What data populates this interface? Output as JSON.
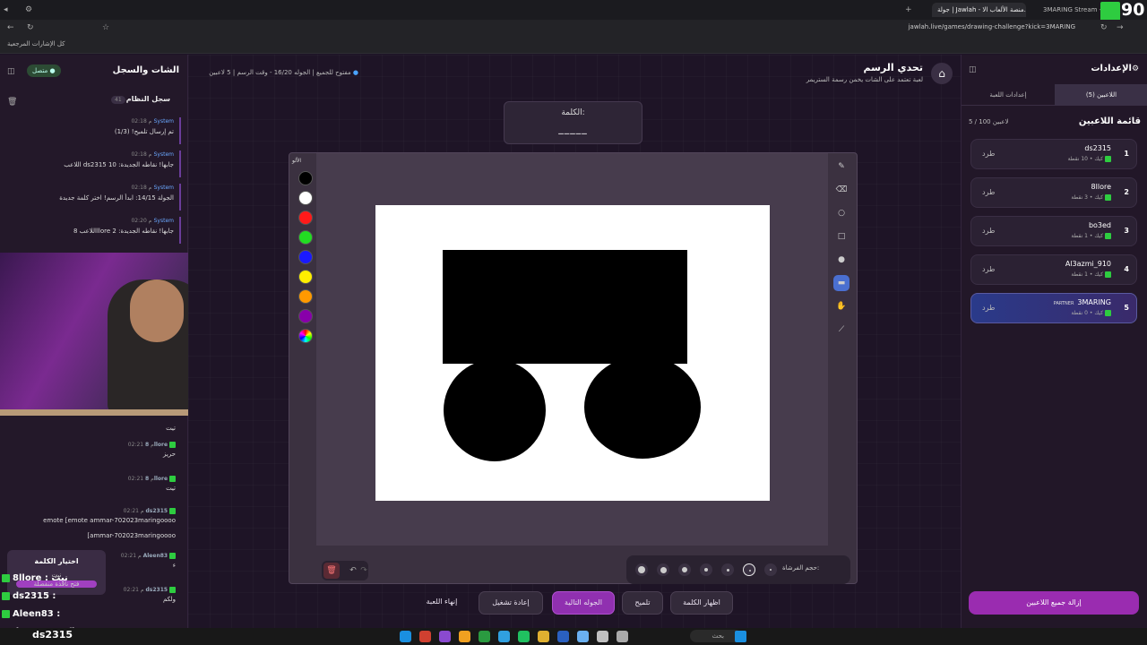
{
  "browser": {
    "tabs": [
      "جولة | Jawlah - منصة الألعاب الا...",
      "3MARING Stream - Watc..."
    ],
    "url": "jawlah.live/games/drawing-challenge?kick=3MARING",
    "bookmarks": "كل الإشارات المرجعية"
  },
  "stream_overlay": {
    "viewer_count": "90"
  },
  "chat": {
    "title": "الشات والسجل",
    "status": "متصل",
    "log_title": "سجل النظام",
    "log_count": "41",
    "system_messages": [
      {
        "sender": "System",
        "time": "02:18 م",
        "text": "تم إرسال تلميح! (1/3)"
      },
      {
        "sender": "System",
        "time": "02:18 م",
        "text": "اللاعب ds2315 جابها! نقاطه الجديدة: 10"
      },
      {
        "sender": "System",
        "time": "02:18 م",
        "text": "الجولة 14/15: ابدأ الرسم! اختر كلمة جديدة"
      },
      {
        "sender": "System",
        "time": "02:20 م",
        "text": "اللاعب 8llore جابها! نقاطه الجديدة: 2"
      }
    ],
    "user_messages": [
      {
        "sender": "",
        "time": "",
        "text": "تيت"
      },
      {
        "sender": "8llore",
        "time": "02:21 م",
        "text": "حريز"
      },
      {
        "sender": "8llore",
        "time": "02:21 م",
        "text": "تيت"
      },
      {
        "sender": "ds2315",
        "time": "02:21 م",
        "text": "emote [emote ammar-702023maringoooo"
      },
      {
        "sender": "",
        "time": "",
        "text": "[ammar-702023maringoooo"
      },
      {
        "sender": "Aleen83",
        "time": "02:21 م",
        "text": "ء"
      },
      {
        "sender": "ds2315",
        "time": "02:21 م",
        "text": "ولكم"
      }
    ],
    "choose_word_popup": {
      "title": "اختيار الكلمة",
      "subtitle": "نيت",
      "open_window": "فتح نافذة منفصلة"
    },
    "stream_chat": [
      {
        "name": "8llore",
        "text": "نيت"
      },
      {
        "name": "ds2315",
        "text": ""
      },
      {
        "name": "Aleen83",
        "text": ""
      },
      {
        "name": "ds2315",
        "text": "ولكم"
      }
    ]
  },
  "header": {
    "title": "تحدي الرسم",
    "subtitle": "لعبة تعتمد على الشات يخمن رسمة الستريمر",
    "players": "5 لاعبين",
    "round": "الجوله 16/20 - وقت الرسم",
    "mode": "مفتوح للجميع"
  },
  "word_box": {
    "label": "الكلمة:",
    "value": "_____"
  },
  "palette": {
    "label": "الألو",
    "colors": [
      "#000000",
      "#ffffff",
      "#ff1a1a",
      "#22dd22",
      "#1a1aff",
      "#ffee00",
      "#ff9900",
      "#8800aa"
    ]
  },
  "tools": [
    "pencil-icon",
    "eraser-icon",
    "circle-icon",
    "square-icon",
    "filled-circle-icon",
    "filled-rect-icon",
    "fill-icon",
    "line-icon"
  ],
  "brush": {
    "label": "حجم الفرشاة:"
  },
  "actions": {
    "end": "إنهاء اللعبة",
    "restart": "إعادة تشغيل",
    "next": "الجوله التالية",
    "hint": "تلميح",
    "reveal": "اظهار الكلمة"
  },
  "settings": {
    "title": "الإعدادات",
    "tab_players": "اللاعبين (5)",
    "tab_game": "إعدادات اللعبة",
    "list_title": "قائمة اللاعبين",
    "count": "5 / 100 لاعبين",
    "kick_label": "طرد",
    "players": [
      {
        "rank": "1",
        "name": "ds2315",
        "points": "كيك • 10 نقطة"
      },
      {
        "rank": "2",
        "name": "8llore",
        "points": "كيك • 3 نقطة"
      },
      {
        "rank": "3",
        "name": "bo3ed",
        "points": "كيك • 1 نقطة"
      },
      {
        "rank": "4",
        "name": "Al3azmi_910",
        "points": "كيك • 1 نقطة"
      },
      {
        "rank": "5",
        "name": "3MARING",
        "badge": "PARTNER",
        "points": "كيك • 0 نقطة"
      }
    ],
    "remove_all": "إزالة جميع اللاعبين"
  },
  "taskbar": {
    "search": "بحث",
    "user_overlay": "ds2315"
  },
  "colors": {
    "accent": "#9030b0",
    "bg": "#1e1426",
    "kick_green": "#2ecc40"
  }
}
